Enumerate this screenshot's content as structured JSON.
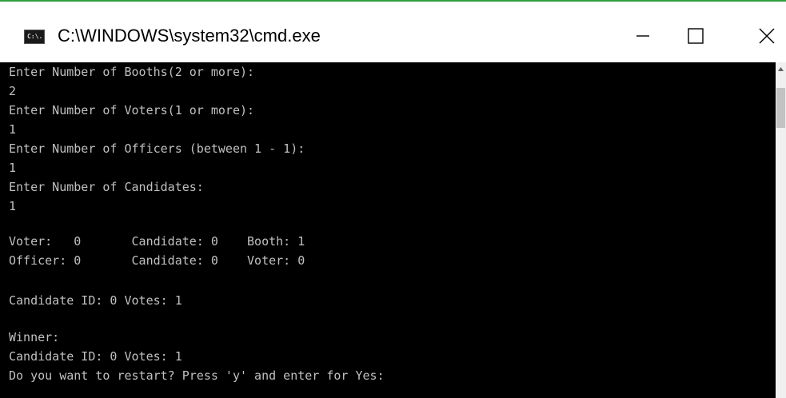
{
  "window": {
    "title": "C:\\WINDOWS\\system32\\cmd.exe",
    "icon_text": "C:\\.",
    "icon": "cmd-icon",
    "accent_color": "#2e9e3e",
    "background_color": "#000000",
    "text_color": "#c0c0c0"
  },
  "controls": {
    "minimize_icon": "minimize-icon",
    "maximize_icon": "maximize-icon",
    "close_icon": "close-icon"
  },
  "console": {
    "lines": [
      "Enter Number of Booths(2 or more):",
      "2",
      "Enter Number of Voters(1 or more):",
      "1",
      "Enter Number of Officers (between 1 - 1):",
      "1",
      "Enter Number of Candidates:",
      "1",
      "",
      "Voter:   0       Candidate: 0    Booth: 1",
      "Officer: 0       Candidate: 0    Voter: 0",
      "",
      "Candidate ID: 0 Votes: 1",
      "",
      "Winner:",
      "Candidate ID: 0 Votes: 1",
      "Do you want to restart? Press 'y' and enter for Yes:"
    ]
  }
}
